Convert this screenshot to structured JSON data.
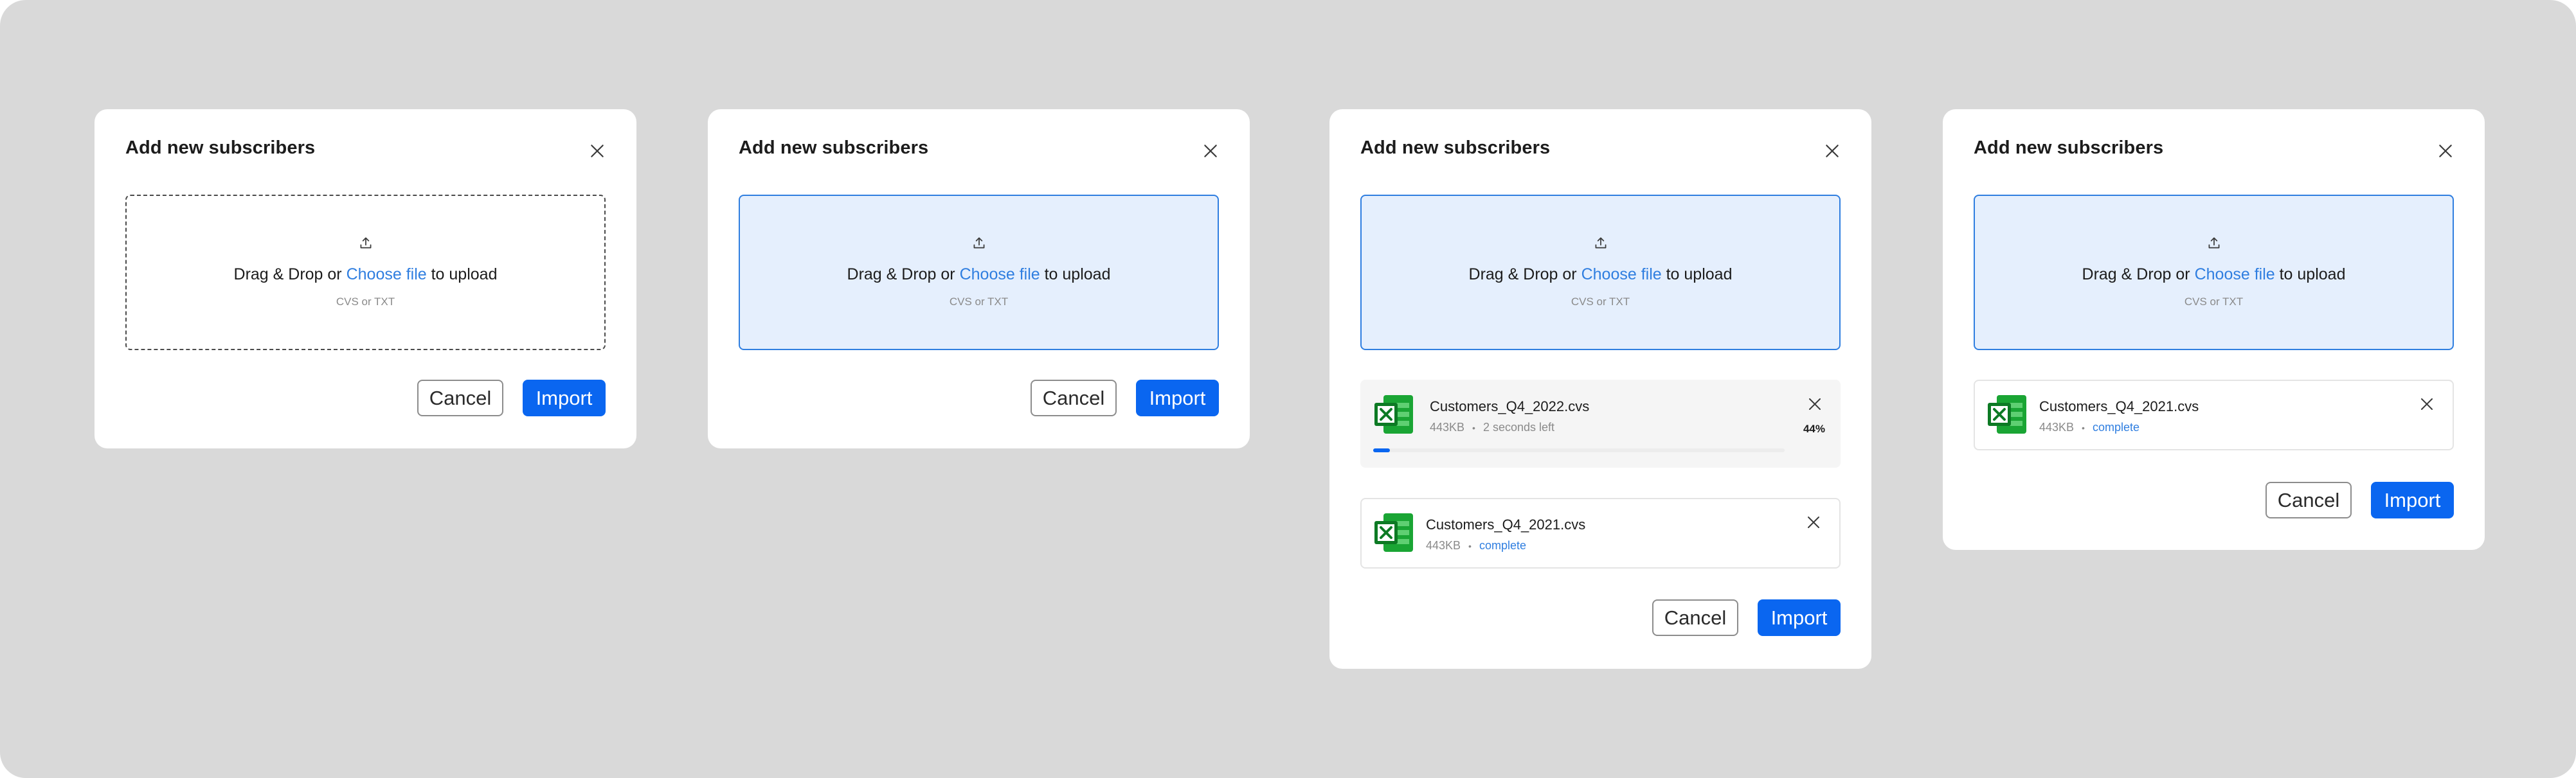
{
  "colors": {
    "background": "#d9d9d9",
    "accent": "#0a66f0",
    "link": "#2f7ee0",
    "dropzone_active_bg": "#e5effd",
    "excel_green": "#1aa534"
  },
  "icons": {
    "close": "close-icon",
    "upload": "upload-icon",
    "file": "excel-file-icon"
  },
  "modals": [
    {
      "title": "Add new subscribers",
      "dropzone": {
        "state": "idle",
        "prefix": "Drag & Drop or ",
        "link": "Choose file",
        "suffix": " to upload",
        "hint": "CVS or TXT"
      },
      "cancel_label": "Cancel",
      "import_label": "Import"
    },
    {
      "title": "Add new subscribers",
      "dropzone": {
        "state": "active",
        "prefix": "Drag & Drop or ",
        "link": "Choose file",
        "suffix": " to upload",
        "hint": "CVS or TXT"
      },
      "cancel_label": "Cancel",
      "import_label": "Import"
    },
    {
      "title": "Add new subscribers",
      "dropzone": {
        "state": "active",
        "prefix": "Drag & Drop or ",
        "link": "Choose file",
        "suffix": " to upload",
        "hint": "CVS or TXT"
      },
      "files": [
        {
          "name": "Customers_Q4_2022.cvs",
          "size": "443KB",
          "separator": "•",
          "status": "2 seconds left",
          "percent_label": "44%",
          "progress": 0.04
        },
        {
          "name": "Customers_Q4_2021.cvs",
          "size": "443KB",
          "separator": "•",
          "status": "complete"
        }
      ],
      "cancel_label": "Cancel",
      "import_label": "Import"
    },
    {
      "title": "Add new subscribers",
      "dropzone": {
        "state": "active",
        "prefix": "Drag & Drop or ",
        "link": "Choose file",
        "suffix": " to upload",
        "hint": "CVS or TXT"
      },
      "files": [
        {
          "name": "Customers_Q4_2021.cvs",
          "size": "443KB",
          "separator": "•",
          "status": "complete"
        }
      ],
      "cancel_label": "Cancel",
      "import_label": "Import"
    }
  ]
}
